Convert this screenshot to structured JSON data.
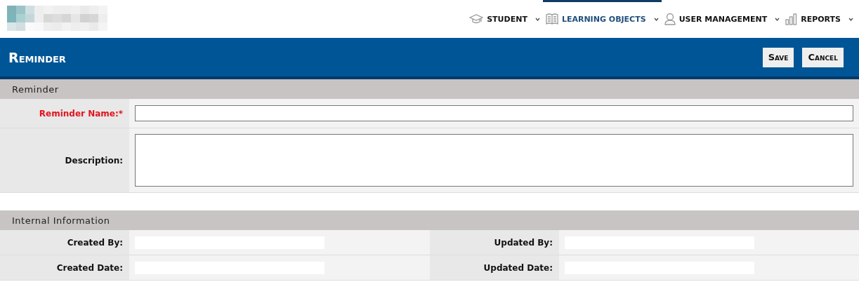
{
  "nav": [
    {
      "label": "STUDENT",
      "selected": false
    },
    {
      "label": "LEARNING OBJECTS",
      "selected": true
    },
    {
      "label": "USER MANAGEMENT",
      "selected": false
    },
    {
      "label": "REPORTS",
      "selected": false
    }
  ],
  "page_title": "Reminder",
  "buttons": [
    "Save",
    "Cancel"
  ],
  "sections": [
    {
      "title": "Reminder",
      "kind": "form",
      "fields": [
        {
          "label": "Reminder Name:*",
          "required": true,
          "kind": "input"
        },
        {
          "label": "Description:",
          "required": false,
          "kind": "textarea"
        }
      ]
    },
    {
      "title": "Internal Information",
      "kind": "info",
      "rows": [
        [
          {
            "label": "Created By:"
          },
          {
            "label": "Updated By:"
          }
        ],
        [
          {
            "label": "Created Date:"
          },
          {
            "label": "Updated Date:"
          }
        ]
      ]
    }
  ]
}
